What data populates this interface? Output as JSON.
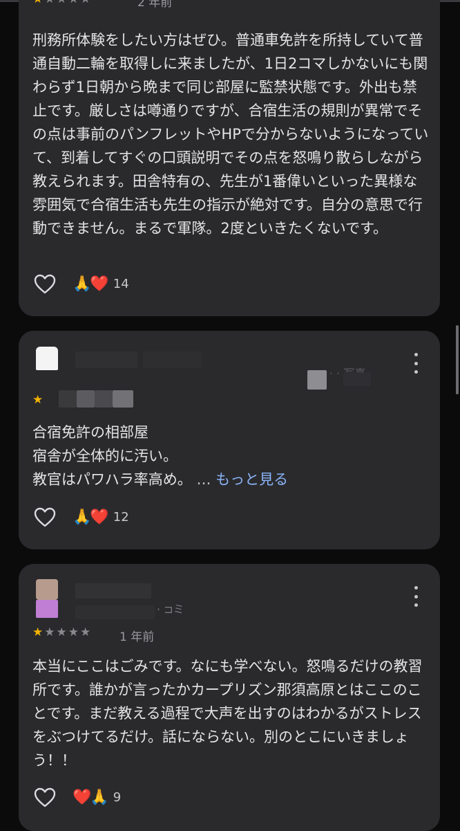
{
  "reviews": [
    {
      "rating": "1",
      "date": "2 年前",
      "text": "刑務所体験をしたい方はぜひ。普通車免許を所持していて普通自動二輪を取得しに来ましたが、1日2コマしかないにも関わらず1日朝から晩まで同じ部屋に監禁状態です。外出も禁止です。厳しさは噂通りですが、合宿生活の規則が異常でその点は事前のパンフレットやHPで分からないようになっていて、到着してすぐの口頭説明でその点を怒鳴り散らしながら教えられます。田舎特有の、先生が1番偉いといった異様な雰囲気で合宿生活も先生の指示が絶対です。自分の意思で行動できません。まるで軍隊。2度といきたくないです。",
      "reactions": "🙏❤️",
      "reaction_count": "14"
    },
    {
      "rating": "1",
      "text_lines": [
        "合宿免許の相部屋",
        "宿舎が全体的に汚い。",
        "教官はパワハラ率高め。"
      ],
      "ellipsis": "…",
      "more_label": "もっと見る",
      "reactions": "🙏❤️",
      "reaction_count": "12"
    },
    {
      "rating": "1",
      "date": "1 年前",
      "text": "本当にここはごみです。なにも学べない。怒鳴るだけの教習所です。誰かが言ったかカープリズン那須高原とはここのことです。まだ教える過程で大声を出すのはわかるがストレスをぶつけてるだけ。話にならない。別のとこにいきましょう！！",
      "reactions": "❤️🙏",
      "reaction_count": "9"
    }
  ],
  "icons": {
    "like": "heart-outline-icon",
    "menu": "more-vert-icon",
    "star": "star-icon"
  },
  "colors": {
    "card_bg": "#2a2a2d",
    "page_bg": "#0b0b0c",
    "star": "#f5b400",
    "link": "#8ab4f8"
  }
}
